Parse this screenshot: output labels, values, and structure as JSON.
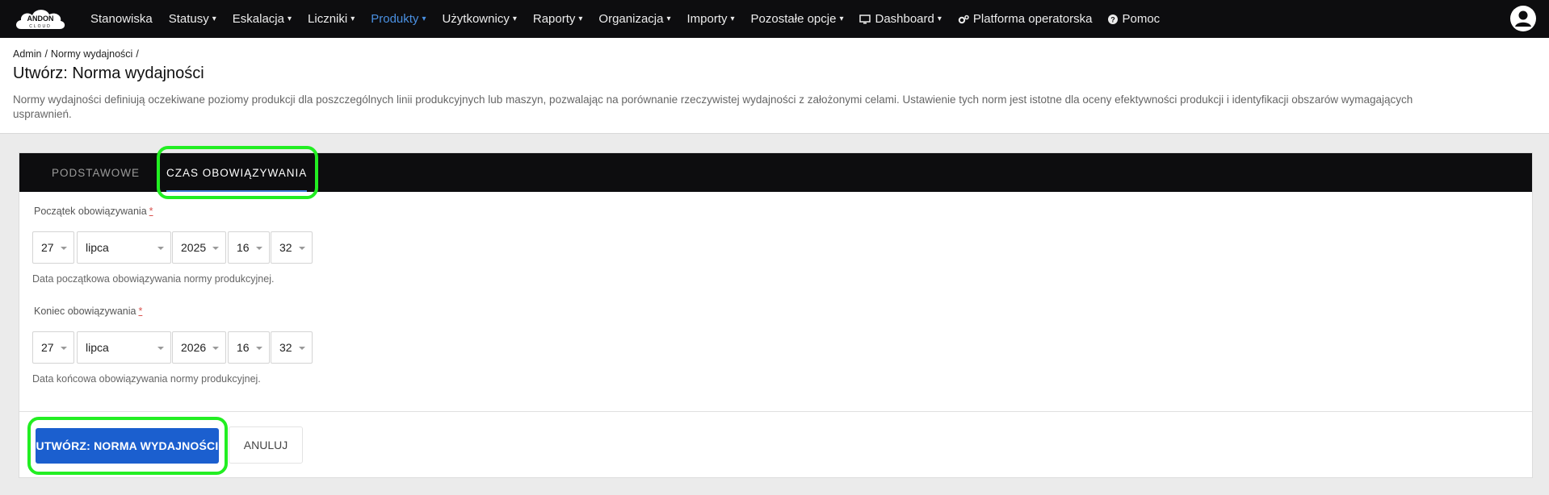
{
  "nav": {
    "logo_text": "ANDON CLOUD",
    "items": [
      {
        "label": "Stanowiska",
        "caret": ""
      },
      {
        "label": "Statusy",
        "caret": "▾"
      },
      {
        "label": "Eskalacja",
        "caret": "▾"
      },
      {
        "label": "Liczniki",
        "caret": "▾"
      },
      {
        "label": "Produkty",
        "caret": "▾"
      },
      {
        "label": "Użytkownicy",
        "caret": "▾"
      },
      {
        "label": "Raporty",
        "caret": "▾"
      },
      {
        "label": "Organizacja",
        "caret": "▾"
      },
      {
        "label": "Importy",
        "caret": "▾"
      },
      {
        "label": "Pozostałe opcje",
        "caret": "▾"
      },
      {
        "label": "Dashboard",
        "caret": "▾"
      },
      {
        "label": "Platforma operatorska",
        "caret": ""
      },
      {
        "label": "Pomoc",
        "caret": ""
      }
    ],
    "active_color": "#4a90e2"
  },
  "breadcrumb": [
    "Admin",
    "/",
    "Normy wydajności",
    "/"
  ],
  "page": {
    "title": "Utwórz: Norma wydajności",
    "description": "Normy wydajności definiują oczekiwane poziomy produkcji dla poszczególnych linii produkcyjnych lub maszyn, pozwalając na porównanie rzeczywistej wydajności z założonymi celami. Ustawienie tych norm jest istotne dla oceny efektywności produkcji i identyfikacji obszarów wymagających usprawnień."
  },
  "tabs": {
    "basic": "PODSTAWOWE",
    "time": "CZAS OBOWIĄZYWANIA"
  },
  "start": {
    "label": "Początek obowiązywania",
    "required_mark": "*",
    "day": "27",
    "month": "lipca",
    "year": "2025",
    "hour": "16",
    "minute": "32",
    "help": "Data początkowa obowiązywania normy produkcyjnej."
  },
  "end": {
    "label": "Koniec obowiązywania",
    "required_mark": "*",
    "day": "27",
    "month": "lipca",
    "year": "2026",
    "hour": "16",
    "minute": "32",
    "help": "Data końcowa obowiązywania normy produkcyjnej."
  },
  "actions": {
    "submit": "UTWÓRZ: NORMA WYDAJNOŚCI",
    "cancel": "ANULUJ"
  },
  "colors": {
    "primary": "#1b5fcf",
    "highlight": "#22ee22",
    "navbar": "#0d0d0f"
  }
}
